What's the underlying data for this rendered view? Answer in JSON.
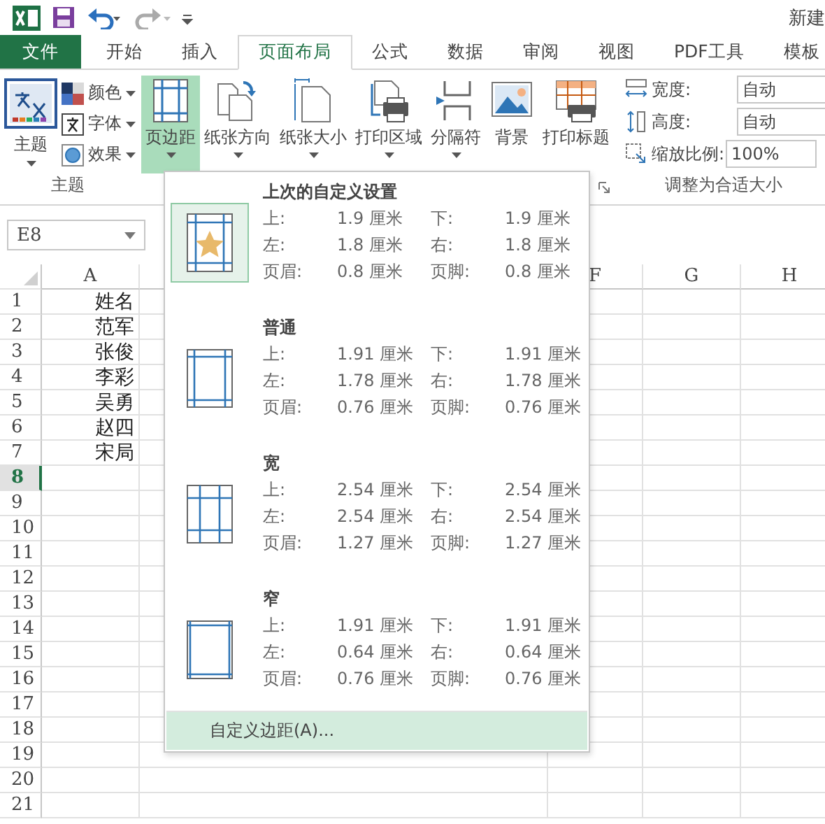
{
  "title_bar": {
    "title": "新建"
  },
  "tabs": [
    {
      "label": "文件",
      "kind": "file",
      "selected": false
    },
    {
      "label": "开始",
      "kind": "tab",
      "selected": false
    },
    {
      "label": "插入",
      "kind": "tab",
      "selected": false
    },
    {
      "label": "页面布局",
      "kind": "tab",
      "selected": true
    },
    {
      "label": "公式",
      "kind": "tab",
      "selected": false
    },
    {
      "label": "数据",
      "kind": "tab",
      "selected": false
    },
    {
      "label": "审阅",
      "kind": "tab",
      "selected": false
    },
    {
      "label": "视图",
      "kind": "tab",
      "selected": false
    },
    {
      "label": "PDF工具",
      "kind": "tab",
      "selected": false
    },
    {
      "label": "模板",
      "kind": "tab",
      "selected": false
    }
  ],
  "theme_group": {
    "label": "主题",
    "big_button": "主题",
    "small_buttons": [
      {
        "label": "颜色",
        "kind": "colors"
      },
      {
        "label": "字体",
        "kind": "fonts"
      },
      {
        "label": "效果",
        "kind": "effects"
      }
    ]
  },
  "page_setup_buttons": [
    {
      "label": "页边距",
      "kind": "margins",
      "selected": true,
      "has_dropdown": true
    },
    {
      "label": "纸张方向",
      "kind": "orientation",
      "selected": false,
      "has_dropdown": true
    },
    {
      "label": "纸张大小",
      "kind": "size",
      "selected": false,
      "has_dropdown": true
    },
    {
      "label": "打印区域",
      "kind": "print_area",
      "selected": false,
      "has_dropdown": true
    },
    {
      "label": "分隔符",
      "kind": "breaks",
      "selected": false,
      "has_dropdown": true
    },
    {
      "label": "背景",
      "kind": "background",
      "selected": false,
      "has_dropdown": false
    },
    {
      "label": "打印标题",
      "kind": "print_titles",
      "selected": false,
      "has_dropdown": false
    }
  ],
  "scale_group": {
    "label": "调整为合适大小",
    "rows": [
      {
        "label": "宽度:",
        "value": "自动",
        "kind": "width"
      },
      {
        "label": "高度:",
        "value": "自动",
        "kind": "height"
      },
      {
        "label": "缩放比例:",
        "value": "100%",
        "kind": "scale"
      }
    ]
  },
  "name_box": {
    "value": "E8"
  },
  "sheet": {
    "columns": [
      "A",
      "F",
      "G",
      "H"
    ],
    "rows": [
      {
        "number": "1",
        "selected": false,
        "cells": [
          "姓名"
        ]
      },
      {
        "number": "2",
        "selected": false,
        "cells": [
          "范军"
        ]
      },
      {
        "number": "3",
        "selected": false,
        "cells": [
          "张俊"
        ]
      },
      {
        "number": "4",
        "selected": false,
        "cells": [
          "李彩"
        ]
      },
      {
        "number": "5",
        "selected": false,
        "cells": [
          "吴勇"
        ]
      },
      {
        "number": "6",
        "selected": false,
        "cells": [
          "赵四"
        ]
      },
      {
        "number": "7",
        "selected": false,
        "cells": [
          "宋局"
        ]
      },
      {
        "number": "8",
        "selected": true,
        "cells": []
      },
      {
        "number": "9",
        "selected": false,
        "cells": []
      },
      {
        "number": "10",
        "selected": false,
        "cells": []
      },
      {
        "number": "11",
        "selected": false,
        "cells": []
      },
      {
        "number": "12",
        "selected": false,
        "cells": []
      },
      {
        "number": "13",
        "selected": false,
        "cells": []
      },
      {
        "number": "14",
        "selected": false,
        "cells": []
      },
      {
        "number": "15",
        "selected": false,
        "cells": []
      },
      {
        "number": "16",
        "selected": false,
        "cells": []
      },
      {
        "number": "17",
        "selected": false,
        "cells": []
      },
      {
        "number": "18",
        "selected": false,
        "cells": []
      },
      {
        "number": "19",
        "selected": false,
        "cells": []
      },
      {
        "number": "20",
        "selected": false,
        "cells": []
      },
      {
        "number": "21",
        "selected": false,
        "cells": []
      }
    ]
  },
  "margins_menu": {
    "presets": [
      {
        "title": "上次的自定义设置",
        "kind": "custom",
        "selected": true,
        "values": [
          {
            "label": "上:",
            "value": "1.9 厘米"
          },
          {
            "label": "下:",
            "value": "1.9 厘米"
          },
          {
            "label": "左:",
            "value": "1.8 厘米"
          },
          {
            "label": "右:",
            "value": "1.8 厘米"
          },
          {
            "label": "页眉:",
            "value": "0.8 厘米"
          },
          {
            "label": "页脚:",
            "value": "0.8 厘米"
          }
        ]
      },
      {
        "title": "普通",
        "kind": "normal",
        "selected": false,
        "values": [
          {
            "label": "上:",
            "value": "1.91 厘米"
          },
          {
            "label": "下:",
            "value": "1.91 厘米"
          },
          {
            "label": "左:",
            "value": "1.78 厘米"
          },
          {
            "label": "右:",
            "value": "1.78 厘米"
          },
          {
            "label": "页眉:",
            "value": "0.76 厘米"
          },
          {
            "label": "页脚:",
            "value": "0.76 厘米"
          }
        ]
      },
      {
        "title": "宽",
        "kind": "wide",
        "selected": false,
        "values": [
          {
            "label": "上:",
            "value": "2.54 厘米"
          },
          {
            "label": "下:",
            "value": "2.54 厘米"
          },
          {
            "label": "左:",
            "value": "2.54 厘米"
          },
          {
            "label": "右:",
            "value": "2.54 厘米"
          },
          {
            "label": "页眉:",
            "value": "1.27 厘米"
          },
          {
            "label": "页脚:",
            "value": "1.27 厘米"
          }
        ]
      },
      {
        "title": "窄",
        "kind": "narrow",
        "selected": false,
        "values": [
          {
            "label": "上:",
            "value": "1.91 厘米"
          },
          {
            "label": "下:",
            "value": "1.91 厘米"
          },
          {
            "label": "左:",
            "value": "0.64 厘米"
          },
          {
            "label": "右:",
            "value": "0.64 厘米"
          },
          {
            "label": "页眉:",
            "value": "0.76 厘米"
          },
          {
            "label": "页脚:",
            "value": "0.76 厘米"
          }
        ]
      }
    ],
    "footer": {
      "label": "自定义边距(A)...",
      "hovered": true
    }
  }
}
